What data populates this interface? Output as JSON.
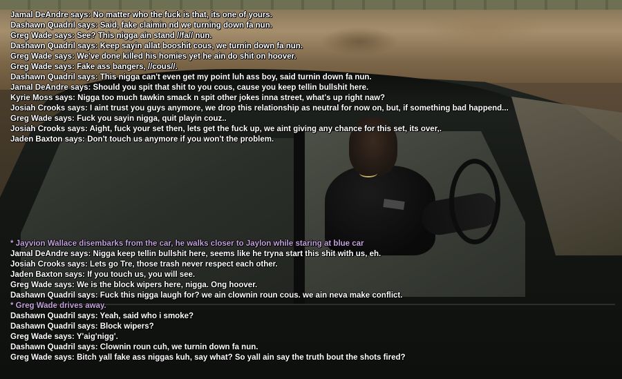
{
  "colors": {
    "chat_text": "#ffffff",
    "action_text": "#c2a2da"
  },
  "chat": {
    "top_lines": [
      {
        "type": "say",
        "text": "Jamal DeAndre says: No matter who the fuck is that, its one of yours."
      },
      {
        "type": "say",
        "text": "Dashawn Quadril says: Said, fake claimin nd we turning down fa nun."
      },
      {
        "type": "say",
        "text": "Greg Wade says: See? This nigga ain stand //fa// nun."
      },
      {
        "type": "say",
        "text": "Dashawn Quadril says: Keep sayin allat booshit cous, we turnin down fa nun."
      },
      {
        "type": "say",
        "text": "Greg Wade says: We've done killed his homies yet he ain do shit on hoover."
      },
      {
        "type": "say",
        "text": "Greg Wade says: Fake ass bangers, //cous//."
      },
      {
        "type": "say",
        "text": "Dashawn Quadril says: This nigga can't even get my point luh ass boy, said turnin down fa nun."
      },
      {
        "type": "say",
        "text": "Jamal DeAndre says: Should you spit that shit to you cous, cause you keep tellin bullshit here."
      },
      {
        "type": "say",
        "text": "Kyrie Moss says: Nigga too much tawkin smack n spit other jokes inna street, what's up right naw?"
      },
      {
        "type": "say",
        "text": "Josiah Crooks says: I aint trust you guys anymore, we drop this relationship as neutral for now on, but, if something bad happend..."
      },
      {
        "type": "say",
        "text": "Greg Wade says: Fuck you sayin nigga, quit playin couz.."
      },
      {
        "type": "say",
        "text": "Josiah Crooks says: Aight, fuck your set then, lets get the fuck up, we aint giving any chance for this set, its over,."
      },
      {
        "type": "say",
        "text": "Jaden Baxton says: Don't touch us anymore if you won't the problem."
      }
    ],
    "bottom_lines": [
      {
        "type": "action",
        "text": "* Jayvion Wallace disembarks from the car, he walks closer to Jaylon while staring at blue car"
      },
      {
        "type": "say",
        "text": "Jamal DeAndre says: Nigga keep tellin bullshit here, seems like he tryna start this shit with us, eh."
      },
      {
        "type": "say",
        "text": "Josiah Crooks says: Lets go Tre, those trash never respect each other."
      },
      {
        "type": "say",
        "text": "Jaden Baxton says: If you touch us, you will see."
      },
      {
        "type": "say",
        "text": "Greg Wade says: We is the block wipers here, nigga. Ong hoover."
      },
      {
        "type": "say",
        "text": "Dashawn Quadril says: Fuck this nigga laugh for? we ain clownin roun cous. we ain neva make conflict."
      },
      {
        "type": "action",
        "text": "* Greg Wade drives away."
      },
      {
        "type": "say",
        "text": "Dashawn Quadril says: Yeah, said who i smoke?"
      },
      {
        "type": "say",
        "text": "Dashawn Quadril says: Block wipers?"
      },
      {
        "type": "say",
        "text": "Greg Wade says: Y'aig'nigg'."
      },
      {
        "type": "say",
        "text": "Dashawn Quadril says: Clownin roun cuh, we turnin down fa nun."
      },
      {
        "type": "say",
        "text": "Greg Wade says: Bitch yall fake ass niggas kuh, say what? So yall ain say the truth bout the shots fired?"
      }
    ]
  }
}
